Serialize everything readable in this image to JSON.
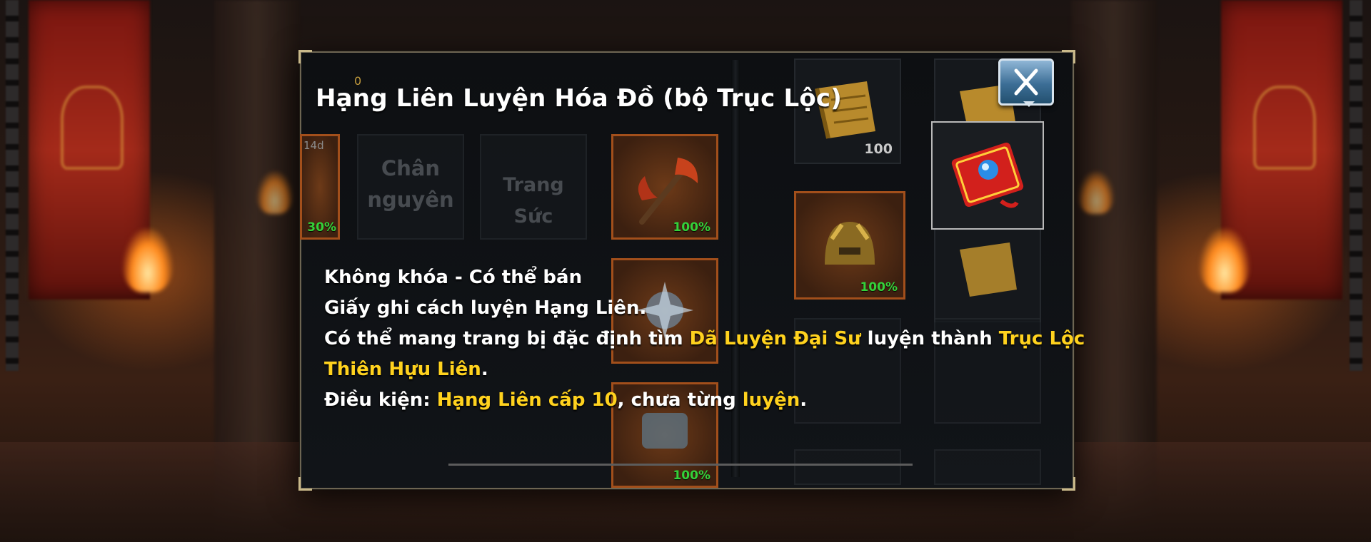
{
  "dialog": {
    "title": "Hạng Liên Luyện Hóa Đồ (bộ Trục Lộc)"
  },
  "inventory": {
    "partial_slot": {
      "top_text": "14d",
      "percent": "30%"
    },
    "slot_chan_nguyen": {
      "line1": "Chân",
      "line2": "nguyên"
    },
    "slot_trang_suc": {
      "label": "Trang Sức"
    },
    "weapon_slot": {
      "percent": "100%"
    },
    "helmet_slot": {
      "percent": "100%"
    },
    "bottom_slot": {
      "percent": "100%"
    },
    "scroll_slot": {
      "quantity": "100"
    },
    "top_counter": "0"
  },
  "item_tooltip": {
    "lock_status": "Không khóa - Có thể bán",
    "description": "Giấy ghi cách luyện Hạng Liên.",
    "usage_prefix": "Có thể mang trang bị đặc định tìm ",
    "npc_name": "Dã Luyện Đại Sư",
    "usage_middle": " luyện thành ",
    "result_item_part1": "Trục Lộc",
    "result_item_part2": "Thiên Hựu Liên",
    "usage_end": ".",
    "condition_label": "Điều kiện: ",
    "condition_value": "Hạng Liên cấp 10",
    "condition_middle": ", chưa từng ",
    "condition_value2": "luyện",
    "condition_end": "."
  },
  "colors": {
    "highlight": "#ffd21e",
    "percent_green": "#34d13a",
    "close_button": "#3c6e96"
  }
}
